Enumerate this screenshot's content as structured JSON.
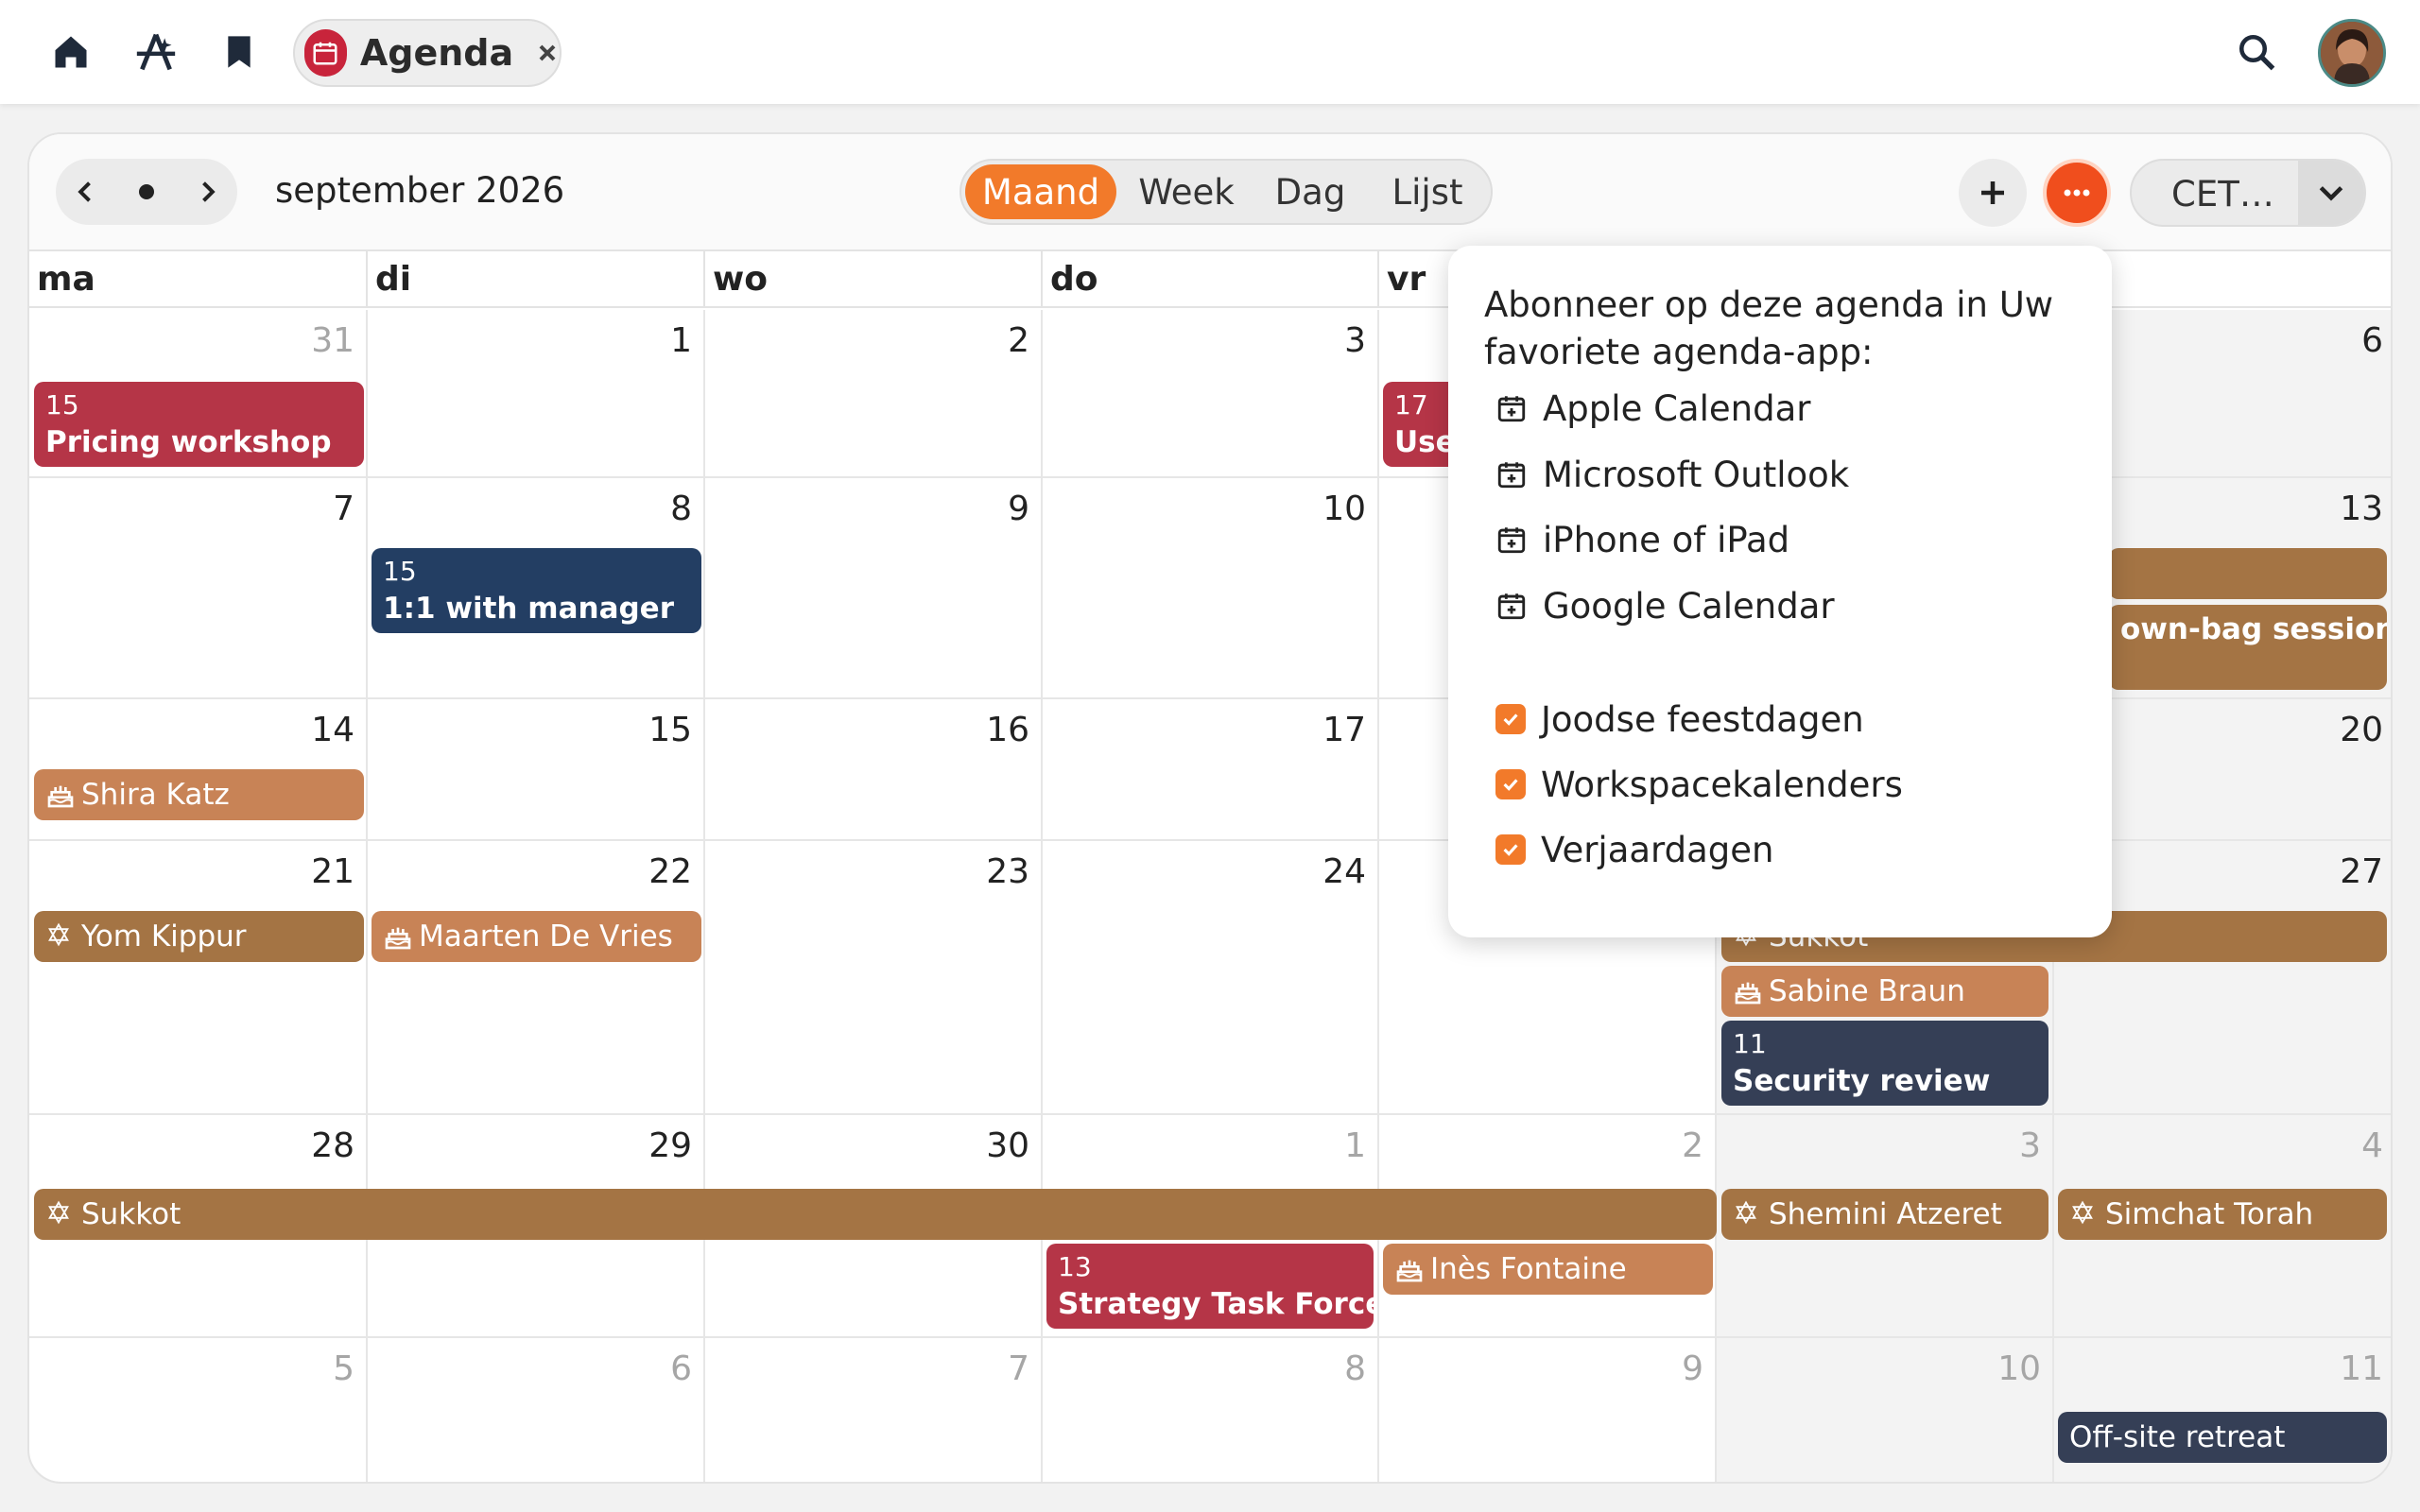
{
  "app": {
    "tab_title": "Agenda",
    "icons": [
      "home-icon",
      "ai-icon",
      "bookmark-icon",
      "calendar-icon",
      "close-icon",
      "search-icon"
    ]
  },
  "toolbar": {
    "month_title": "september 2026",
    "views": [
      "Maand",
      "Week",
      "Dag",
      "Lijst"
    ],
    "active_view": "Maand",
    "timezone": "CET…"
  },
  "colors": {
    "accent": "#f27a2a",
    "more_button": "#f04e1d",
    "event_red": "#b53547",
    "event_navy": "#233e63",
    "event_slate": "#353f56",
    "event_brown": "#a47444",
    "event_tan": "#c88356"
  },
  "weekdays": [
    "ma",
    "di",
    "wo",
    "do",
    "vr",
    "",
    ""
  ],
  "weeks": [
    [
      "31",
      "1",
      "2",
      "3",
      "",
      "",
      "6"
    ],
    [
      "7",
      "8",
      "9",
      "10",
      "",
      "",
      "13"
    ],
    [
      "14",
      "15",
      "16",
      "17",
      "",
      "",
      "20"
    ],
    [
      "21",
      "22",
      "23",
      "24",
      "",
      "",
      "27"
    ],
    [
      "28",
      "29",
      "30",
      "1",
      "2",
      "3",
      "4"
    ],
    [
      "5",
      "6",
      "7",
      "8",
      "9",
      "10",
      "11"
    ]
  ],
  "events": {
    "pricing": {
      "time": "15",
      "title": "Pricing workshop"
    },
    "user": {
      "time": "17",
      "title": "Use"
    },
    "manager": {
      "time": "15",
      "title": "1:1 with manager"
    },
    "brownbag_title": "own-bag session",
    "shira": "Shira Katz",
    "yom_kippur": "Yom Kippur",
    "maarten": "Maarten De Vries",
    "sukkot_top": "Sukkot",
    "sabine": "Sabine Braun",
    "security": {
      "time": "11",
      "title": "Security review"
    },
    "sukkot": "Sukkot",
    "shemini": "Shemini Atzeret",
    "simchat": "Simchat Torah",
    "strategy": {
      "time": "13",
      "title": "Strategy Task Force"
    },
    "ines": "Inès Fontaine",
    "offsite": "Off-site retreat"
  },
  "subscribe_popover": {
    "title": "Abonneer op deze agenda in Uw favoriete agenda-app:",
    "apps": [
      "Apple Calendar",
      "Microsoft Outlook",
      "iPhone of iPad",
      "Google Calendar"
    ],
    "calendars": [
      {
        "label": "Joodse feestdagen",
        "checked": true
      },
      {
        "label": "Workspacekalenders",
        "checked": true
      },
      {
        "label": "Verjaardagen",
        "checked": true
      }
    ]
  }
}
